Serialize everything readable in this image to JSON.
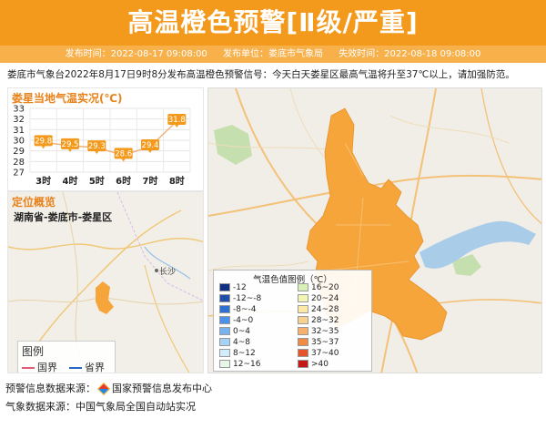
{
  "header": {
    "title": "高温橙色预警[Ⅱ级/严重]",
    "publish_time": "发布时间：2022-08-17 09:08:00",
    "publisher": "发布单位：娄底市气象局",
    "expire_time": "失效时间：2022-08-18 09:08:00"
  },
  "description": "娄底市气象台2022年8月17日9时8分发布高温橙色预警信号：今天白天娄星区最高气温将升至37℃以上，请加强防范。",
  "colors": {
    "banner": "#f39a1c",
    "meta_bar": "#f7b04a",
    "accent": "#e8821a",
    "warning_area": "#f5a53a"
  },
  "temperature_panel": {
    "title": "娄星当地气温实况(℃)"
  },
  "chart_data": {
    "type": "line",
    "title": "娄星当地气温实况(℃)",
    "categories": [
      "3时",
      "4时",
      "5时",
      "6时",
      "7时",
      "8时"
    ],
    "values": [
      29.8,
      29.5,
      29.3,
      28.6,
      29.4,
      31.8
    ],
    "y_ticks": [
      "33",
      "32",
      "31",
      "30",
      "29",
      "28",
      "27"
    ],
    "ylim": [
      27,
      33
    ],
    "grid": true,
    "line_color": "#f1b27a",
    "label_color": "#f39a1c"
  },
  "location_panel": {
    "title": "定位概览",
    "subtitle": "湖南省-娄底市-娄星区",
    "city_label": "长沙",
    "legend": {
      "title": "图例",
      "national": "国界",
      "provincial": "省界"
    }
  },
  "map_legend": {
    "title": "气温色值图例（℃）",
    "items": [
      {
        "label": "-12",
        "color": "#102f80"
      },
      {
        "label": "16~20",
        "color": "#d8f0b8"
      },
      {
        "label": "-12~-8",
        "color": "#1f4fa6"
      },
      {
        "label": "20~24",
        "color": "#f2f5b4"
      },
      {
        "label": "-8~-4",
        "color": "#2e6fd0"
      },
      {
        "label": "24~28",
        "color": "#fbe9a5"
      },
      {
        "label": "-4~0",
        "color": "#4c91e8"
      },
      {
        "label": "28~32",
        "color": "#f9d18e"
      },
      {
        "label": "0~4",
        "color": "#78b3f0"
      },
      {
        "label": "32~35",
        "color": "#f6b06b"
      },
      {
        "label": "4~8",
        "color": "#a6d2f6"
      },
      {
        "label": "35~37",
        "color": "#f08a47"
      },
      {
        "label": "8~12",
        "color": "#d1ecfb"
      },
      {
        "label": "37~40",
        "color": "#e5552b"
      },
      {
        "label": "12~16",
        "color": "#e8f6e8"
      },
      {
        "label": ">40",
        "color": "#c41a1a"
      }
    ]
  },
  "footer": {
    "warning_source_label": "预警信息数据来源：",
    "warning_source": "国家预警信息发布中心",
    "weather_source": "气象数据来源：中国气象局全国自动站实况"
  }
}
